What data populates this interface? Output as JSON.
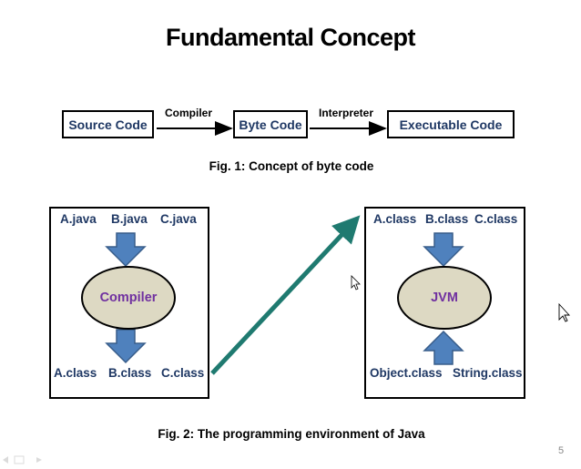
{
  "title": "Fundamental Concept",
  "fig1": {
    "source": "Source Code",
    "compiler_label": "Compiler",
    "byte": "Byte Code",
    "interpreter_label": "Interpreter",
    "executable": "Executable Code",
    "caption": "Fig. 1: Concept of byte code"
  },
  "fig2": {
    "left": {
      "inputs": [
        "A.java",
        "B.java",
        "C.java"
      ],
      "process": "Compiler",
      "outputs": [
        "A.class",
        "B.class",
        "C.class"
      ]
    },
    "right": {
      "inputs": [
        "A.class",
        "B.class",
        "C.class"
      ],
      "process": "JVM",
      "libraries": [
        "Object.class",
        "String.class"
      ]
    },
    "caption": "Fig. 2: The programming environment of Java"
  },
  "page_number": "5",
  "colors": {
    "box_text": "#1f3864",
    "process_text": "#7030a0",
    "ellipse_fill": "#ddd9c3",
    "block_arrow": "#4472c4",
    "connector": "#1f7a70"
  }
}
